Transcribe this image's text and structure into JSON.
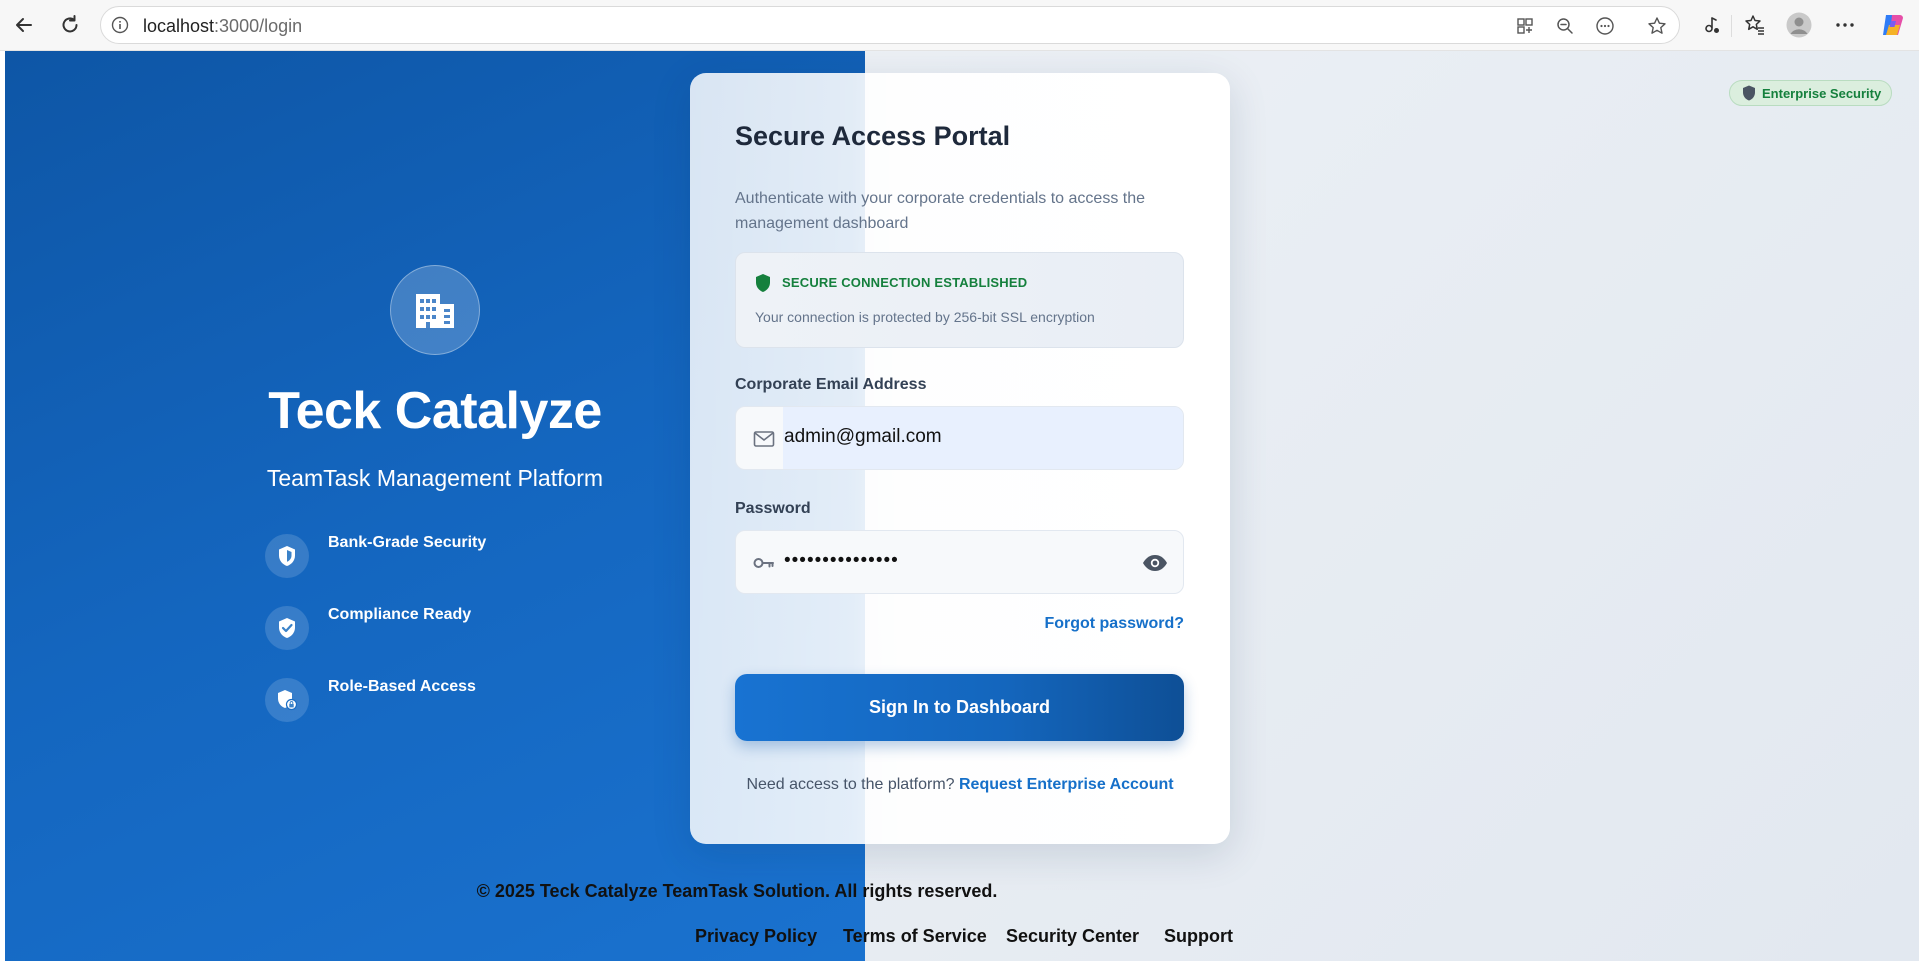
{
  "browser": {
    "url_host": "localhost",
    "url_rest": ":3000/login"
  },
  "brand": {
    "title": "Teck Catalyze",
    "subtitle": "TeamTask Management Platform",
    "features": [
      {
        "label": "Bank-Grade Security",
        "icon": "shield-half-icon"
      },
      {
        "label": "Compliance Ready",
        "icon": "shield-check-icon"
      },
      {
        "label": "Role-Based Access",
        "icon": "shield-lock-icon"
      }
    ]
  },
  "badge": {
    "label": "Enterprise Security"
  },
  "login": {
    "title": "Secure Access Portal",
    "description": "Authenticate with your corporate credentials to access the management dashboard",
    "secure_title": "SECURE CONNECTION ESTABLISHED",
    "secure_text": "Your connection is protected by 256-bit SSL encryption",
    "email_label": "Corporate Email Address",
    "email_value": "admin@gmail.com",
    "password_label": "Password",
    "password_masked": "•••••••••••••••",
    "forgot_link": "Forgot password?",
    "signin_button": "Sign In to Dashboard",
    "request_prompt": "Need access to the platform?",
    "request_link": "Request Enterprise Account"
  },
  "footer": {
    "copyright": "© 2025 Teck Catalyze TeamTask Solution. All rights reserved.",
    "links": [
      "Privacy Policy",
      "Terms of Service",
      "Security Center",
      "Support"
    ]
  },
  "colors": {
    "brand_blue": "#1466bf",
    "accent_link": "#1670c9",
    "success_green": "#15803d"
  }
}
